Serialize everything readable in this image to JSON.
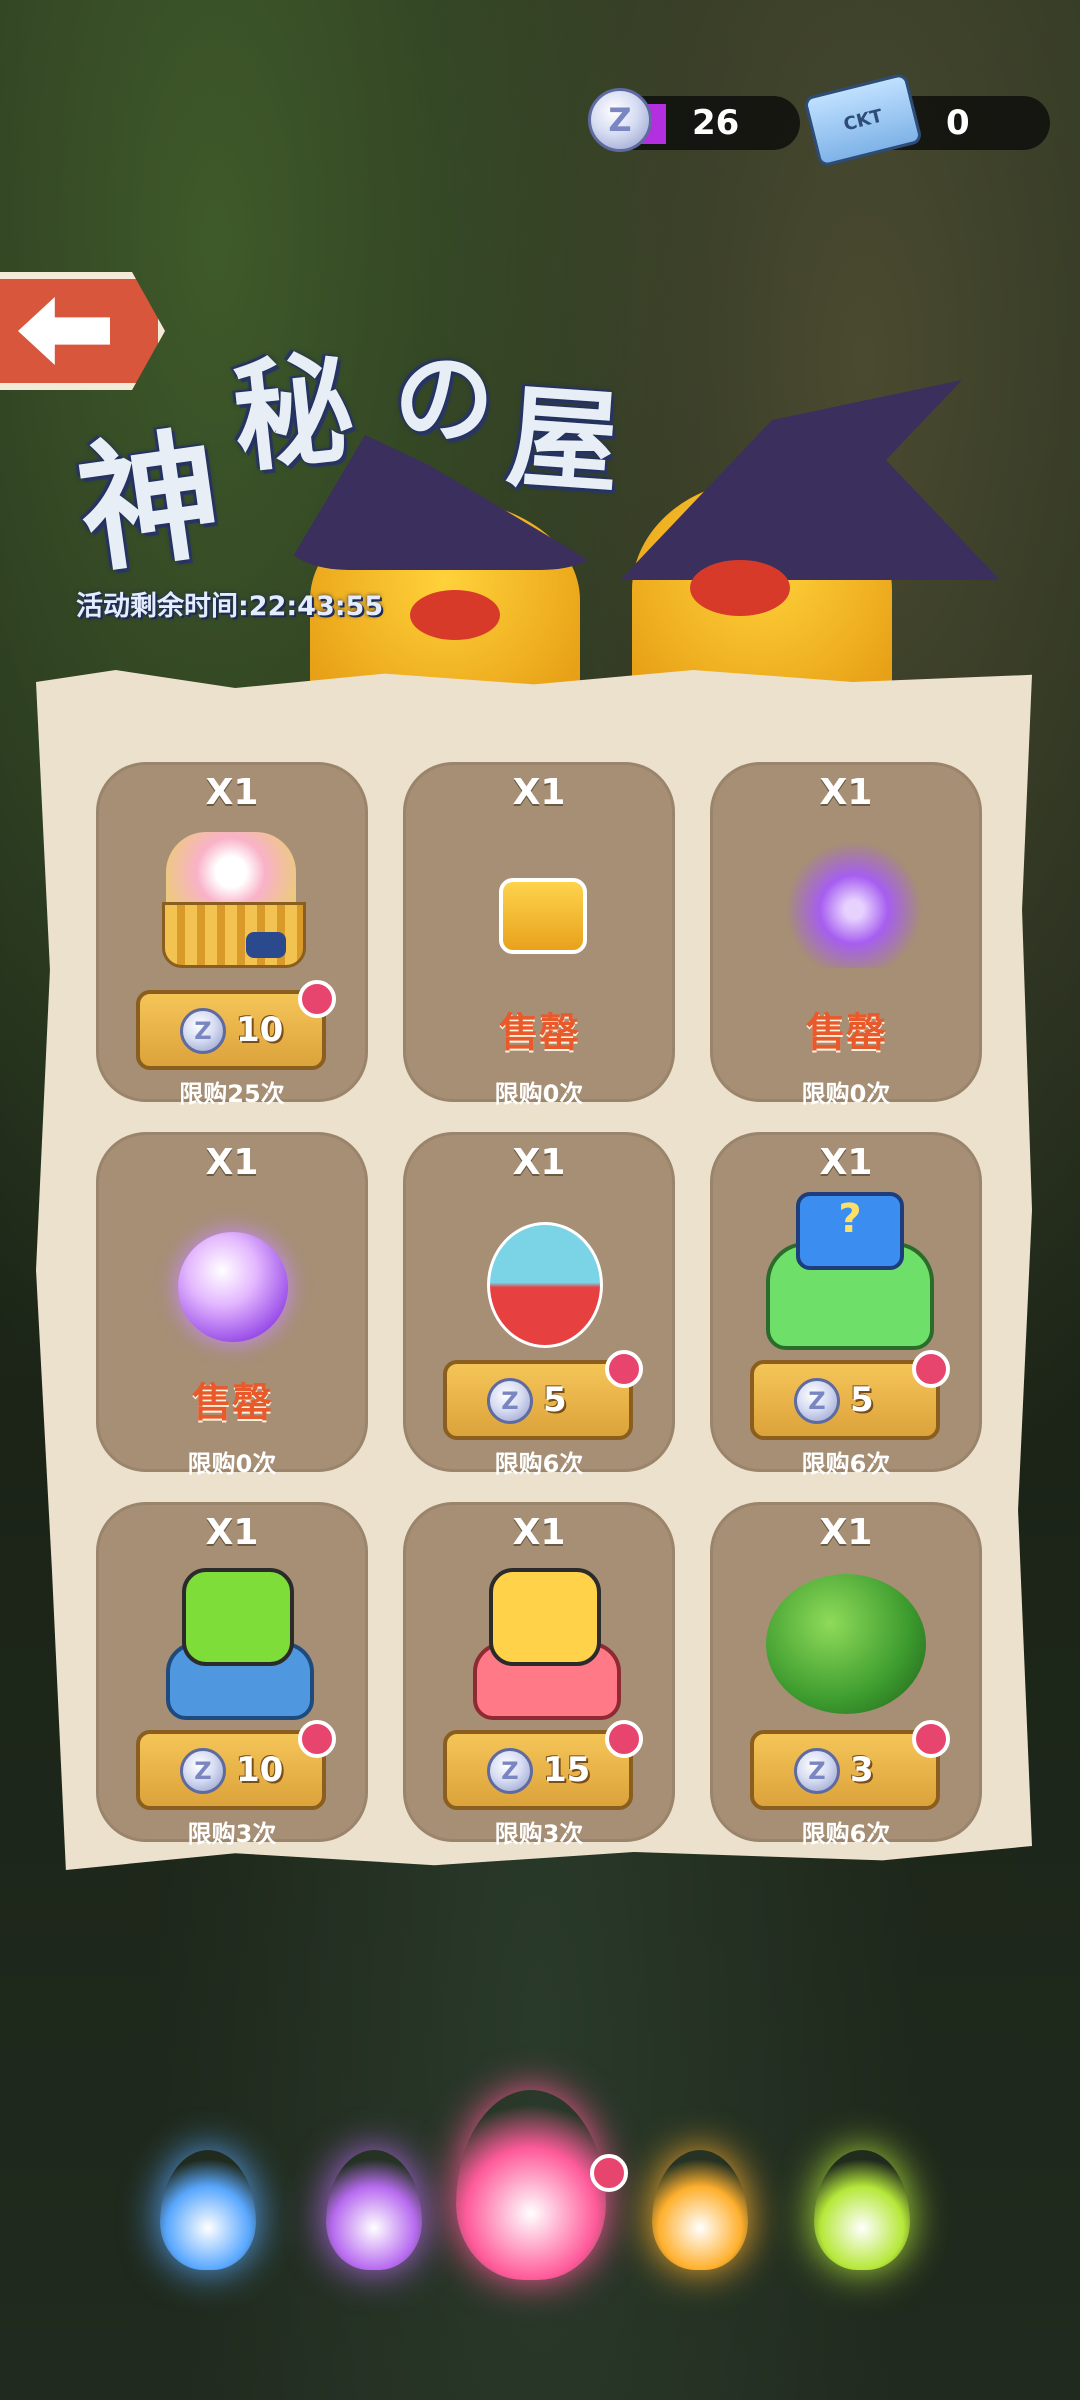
{
  "currencies": [
    {
      "icon": "silver-coin-icon",
      "value": "26"
    },
    {
      "icon": "ticket-icon",
      "value": "0",
      "ticket_text": "CKT"
    }
  ],
  "title": [
    "神",
    "秘",
    "の",
    "屋"
  ],
  "timer": "活动剩余时间:22:43:55",
  "items": [
    {
      "name": "flower-basket-icon",
      "qty": "X1",
      "price": "10",
      "limit": "限购25次",
      "status": "price"
    },
    {
      "name": "yellow-bag-icon",
      "qty": "X1",
      "sold": "售罄",
      "limit": "限购0次",
      "status": "sold"
    },
    {
      "name": "purple-bow-icon",
      "qty": "X1",
      "sold": "售罄",
      "limit": "限购0次",
      "status": "sold"
    },
    {
      "name": "magic-orb-icon",
      "qty": "X1",
      "sold": "售罄",
      "limit": "限购0次",
      "status": "sold"
    },
    {
      "name": "cat-capsule-icon",
      "qty": "X1",
      "price": "5",
      "limit": "限购6次",
      "status": "price"
    },
    {
      "name": "mystery-bag-icon",
      "qty": "X1",
      "price": "5",
      "limit": "限购6次",
      "status": "price"
    },
    {
      "name": "blue-cat-robot-icon",
      "qty": "X1",
      "price": "10",
      "limit": "限购3次",
      "status": "price"
    },
    {
      "name": "pink-cat-robot-icon",
      "qty": "X1",
      "price": "15",
      "limit": "限购3次",
      "status": "price"
    },
    {
      "name": "green-bush-icon",
      "qty": "X1",
      "price": "3",
      "limit": "限购6次",
      "status": "price"
    }
  ],
  "flames": [
    {
      "name": "blue-flame-spirit",
      "color": "#5aa8ff"
    },
    {
      "name": "purple-flame-spirit",
      "color": "#b86cf0"
    },
    {
      "name": "pink-flame-spirit",
      "color": "#ff5b9a"
    },
    {
      "name": "orange-flame-spirit",
      "color": "#ffb02e"
    },
    {
      "name": "lime-flame-spirit",
      "color": "#b6e83a"
    }
  ],
  "colors": {
    "price_accent": "#dca33b",
    "sold_text": "#e85a2c",
    "notify_dot": "#e8456e"
  }
}
